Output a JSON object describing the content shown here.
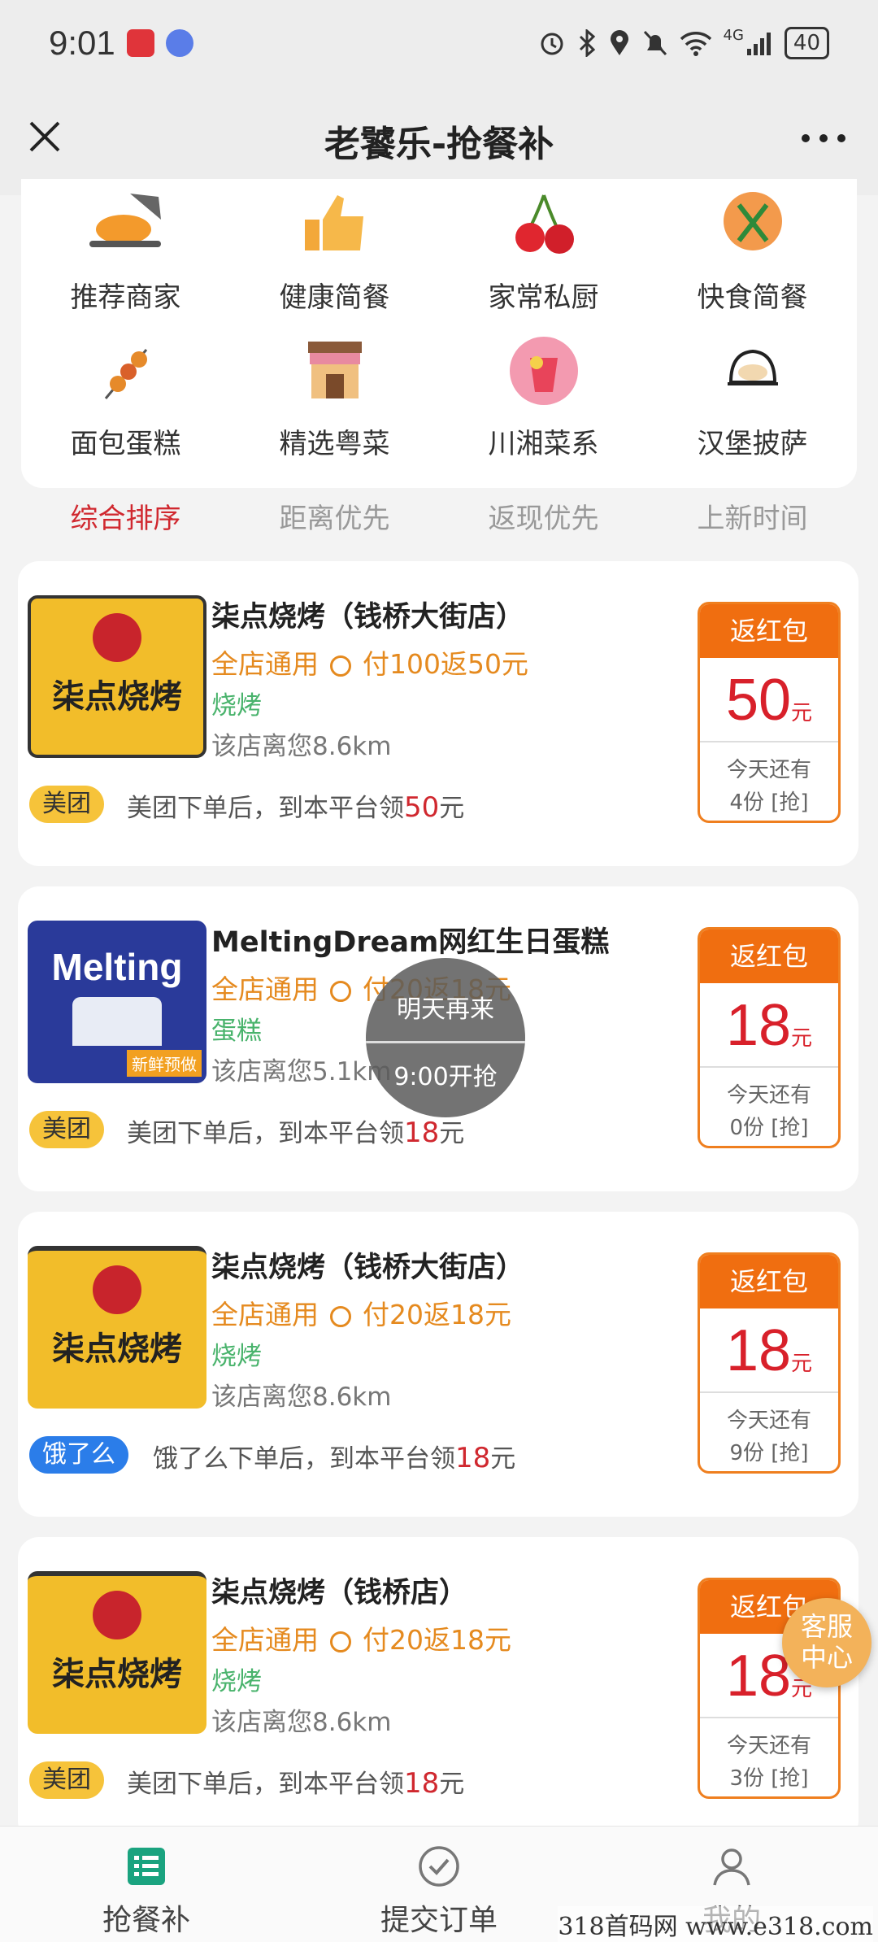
{
  "status_bar": {
    "time": "9:01",
    "battery": "40",
    "network": "4G"
  },
  "nav": {
    "title": "老饕乐-抢餐补"
  },
  "categories": [
    {
      "label": "推荐商家",
      "icon": "roast-chicken-icon"
    },
    {
      "label": "健康简餐",
      "icon": "thumbs-up-icon"
    },
    {
      "label": "家常私厨",
      "icon": "cherry-icon"
    },
    {
      "label": "快食简餐",
      "icon": "fork-spoon-icon"
    },
    {
      "label": "面包蛋糕",
      "icon": "skewer-icon"
    },
    {
      "label": "精选粤菜",
      "icon": "shop-icon"
    },
    {
      "label": "川湘菜系",
      "icon": "drink-icon"
    },
    {
      "label": "汉堡披萨",
      "icon": "bun-icon"
    }
  ],
  "sort_tabs": [
    {
      "label": "综合排序",
      "active": true
    },
    {
      "label": "距离优先",
      "active": false
    },
    {
      "label": "返现优先",
      "active": false
    },
    {
      "label": "上新时间",
      "active": false
    }
  ],
  "shops": [
    {
      "name": "柒点烧烤（钱桥大街店）",
      "promo_scope": "全店通用",
      "promo_rule": "付100返50元",
      "category": "烧烤",
      "distance": "该店离您8.6km",
      "platform": "美团",
      "platform_desc_prefix": "美团下单后，到本平台领",
      "reward": "50",
      "reward_unit": "元",
      "redpack_title": "返红包",
      "remain_line1": "今天还有",
      "remain_line2": "4份 [抢]",
      "logo_text": "柒点烧烤"
    },
    {
      "name": "MeltingDream网红生日蛋糕",
      "promo_scope": "全店通用",
      "promo_rule": "付20返18元",
      "category": "蛋糕",
      "distance": "该店离您5.1km",
      "platform": "美团",
      "platform_desc_prefix": "美团下单后，到本平台领",
      "reward": "18",
      "reward_unit": "元",
      "redpack_title": "返红包",
      "remain_line1": "今天还有",
      "remain_line2": "0份 [抢]",
      "logo_text": "Melting",
      "logo_sub": "新鲜预做",
      "closed_line1": "明天再来",
      "closed_line2": "9:00开抢"
    },
    {
      "name": "柒点烧烤（钱桥大街店）",
      "promo_scope": "全店通用",
      "promo_rule": "付20返18元",
      "category": "烧烤",
      "distance": "该店离您8.6km",
      "platform": "饿了么",
      "platform_desc_prefix": "饿了么下单后，到本平台领",
      "reward": "18",
      "reward_unit": "元",
      "redpack_title": "返红包",
      "remain_line1": "今天还有",
      "remain_line2": "9份 [抢]",
      "logo_text": "柒点烧烤"
    },
    {
      "name": "柒点烧烤（钱桥店）",
      "promo_scope": "全店通用",
      "promo_rule": "付20返18元",
      "category": "烧烤",
      "distance": "该店离您8.6km",
      "platform": "美团",
      "platform_desc_prefix": "美团下单后，到本平台领",
      "reward": "18",
      "reward_unit": "元",
      "redpack_title": "返红包",
      "remain_line1": "今天还有",
      "remain_line2": "3份 [抢]",
      "logo_text": "柒点烧烤"
    }
  ],
  "service_button": {
    "line1": "客服",
    "line2": "中心"
  },
  "tab_bar": [
    {
      "label": "抢餐补",
      "icon": "list-icon",
      "active": true
    },
    {
      "label": "提交订单",
      "icon": "check-circle-icon",
      "active": false
    },
    {
      "label": "我的",
      "icon": "person-icon",
      "active": false
    }
  ],
  "watermark": "318首码网 www.e318.com",
  "colors": {
    "accent_red": "#d0282f",
    "orange": "#f06e10",
    "promo_orange": "#e58a1f",
    "green": "#49b36c",
    "meituan_yellow": "#f6c33a",
    "eleme_blue": "#2b7de9",
    "tab_active": "#1aa37f"
  }
}
